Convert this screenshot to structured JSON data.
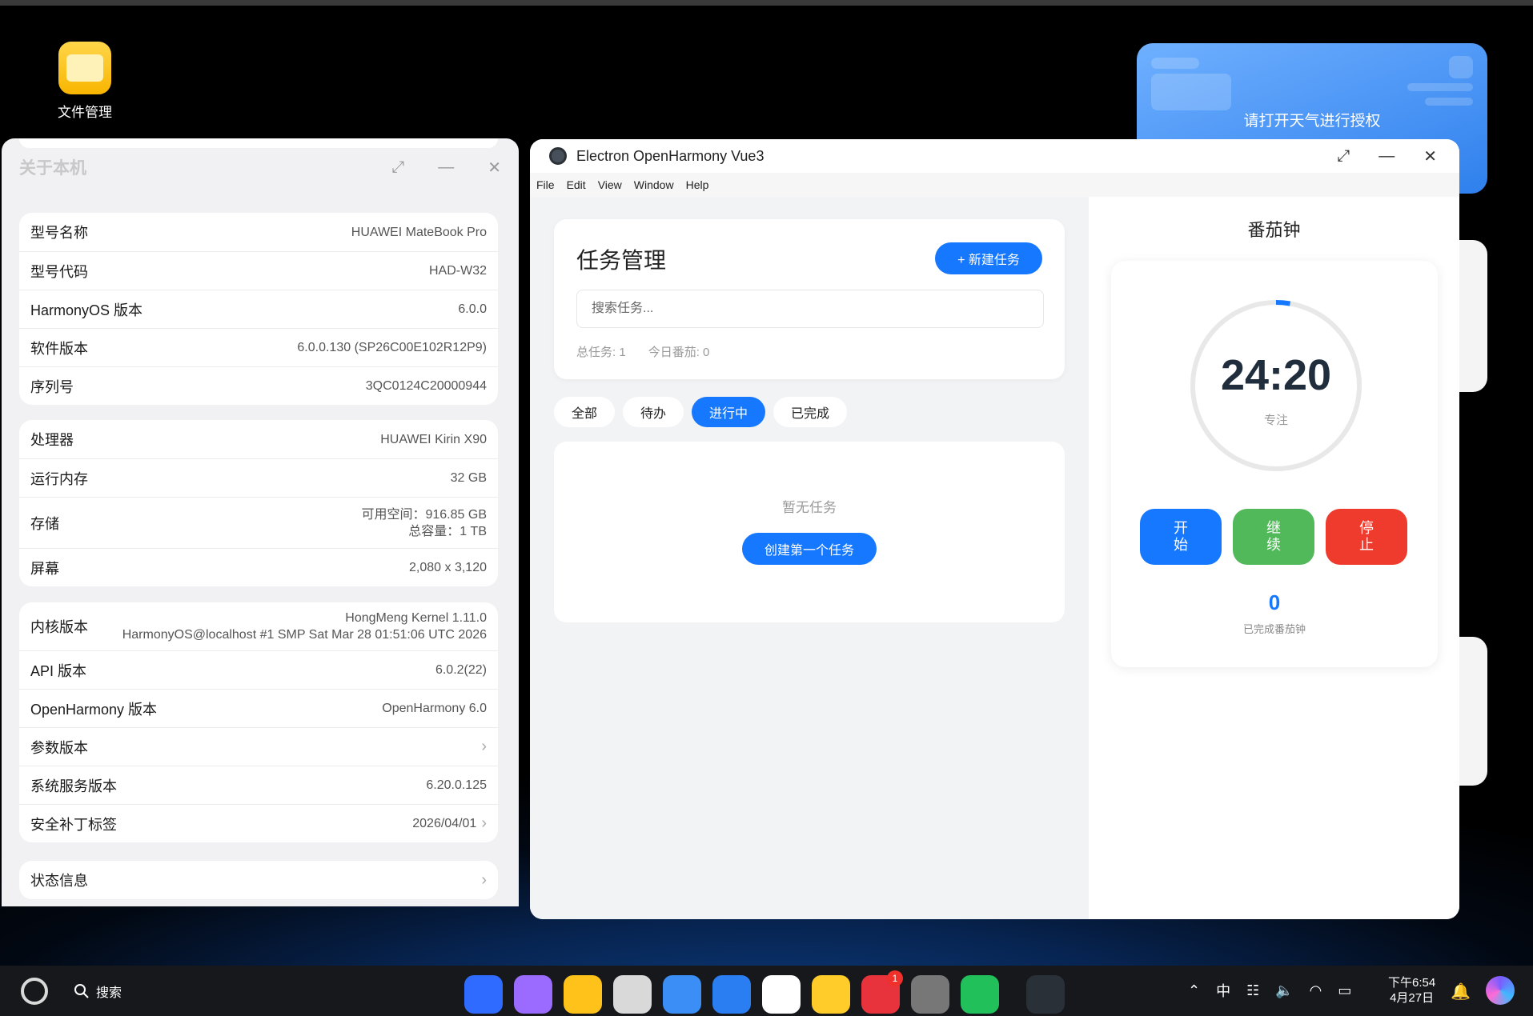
{
  "desktop": {
    "icon_label": "文件管理",
    "weather_text": "请打开天气进行授权"
  },
  "about": {
    "title": "关于本机",
    "device": [
      {
        "k": "型号名称",
        "v": "HUAWEI MateBook Pro"
      },
      {
        "k": "型号代码",
        "v": "HAD-W32"
      },
      {
        "k": "HarmonyOS 版本",
        "v": "6.0.0"
      },
      {
        "k": "软件版本",
        "v": "6.0.0.130 (SP26C00E102R12P9)"
      },
      {
        "k": "序列号",
        "v": "3QC0124C20000944"
      }
    ],
    "hardware": {
      "cpu_k": "处理器",
      "cpu_v": "HUAWEI Kirin X90",
      "ram_k": "运行内存",
      "ram_v": "32 GB",
      "storage_k": "存储",
      "storage_v1": "可用空间：916.85 GB",
      "storage_v2": "总容量：1 TB",
      "screen_k": "屏幕",
      "screen_v": "2,080 x 3,120"
    },
    "kernel": {
      "kernel_k": "内核版本",
      "kernel_v1": "HongMeng Kernel 1.11.0",
      "kernel_v2": "HarmonyOS@localhost #1 SMP Sat Mar 28 01:51:06 UTC 2026",
      "api_k": "API 版本",
      "api_v": "6.0.2(22)",
      "oh_k": "OpenHarmony 版本",
      "oh_v": "OpenHarmony 6.0",
      "param_k": "参数版本",
      "sys_k": "系统服务版本",
      "sys_v": "6.20.0.125",
      "patch_k": "安全补丁标签",
      "patch_v": "2026/04/01"
    },
    "status_k": "状态信息"
  },
  "electron": {
    "title": "Electron OpenHarmony Vue3",
    "menu": [
      "File",
      "Edit",
      "View",
      "Window",
      "Help"
    ],
    "task": {
      "title": "任务管理",
      "new_btn": "+ 新建任务",
      "search_placeholder": "搜索任务...",
      "total": "总任务: 1",
      "today": "今日番茄: 0",
      "tabs": [
        "全部",
        "待办",
        "进行中",
        "已完成"
      ],
      "active_tab": "进行中",
      "empty": "暂无任务",
      "first_btn": "创建第一个任务"
    },
    "pomodoro": {
      "title": "番茄钟",
      "time": "24:20",
      "mode": "专注",
      "progress": 0.027,
      "start": "开\n始",
      "resume": "继\n续",
      "stop": "停\n止",
      "count": "0",
      "count_label": "已完成番茄钟"
    }
  },
  "taskbar": {
    "search": "搜索",
    "app_badge": "1",
    "time": "下午6:54",
    "date": "4月27日"
  },
  "colors": {
    "accent": "#1677ff",
    "green": "#52b95a",
    "red": "#ef3b2d"
  }
}
